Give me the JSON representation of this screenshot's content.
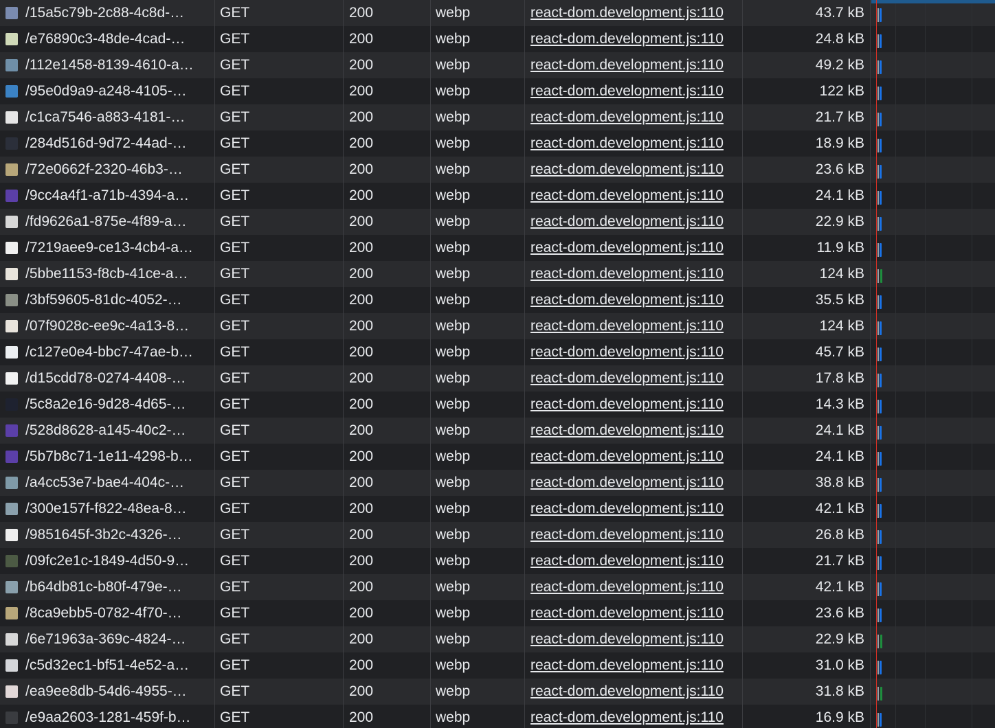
{
  "network": {
    "rows": [
      {
        "name": "/15a5c79b-2c88-4c8d-…",
        "method": "GET",
        "status": "200",
        "type": "webp",
        "initiator": "react-dom.development.js:110",
        "size": "43.7 kB",
        "thumb": "#7a8bb0"
      },
      {
        "name": "/e76890c3-48de-4cad-…",
        "method": "GET",
        "status": "200",
        "type": "webp",
        "initiator": "react-dom.development.js:110",
        "size": "24.8 kB",
        "thumb": "#cfd9b8"
      },
      {
        "name": "/112e1458-8139-4610-a…",
        "method": "GET",
        "status": "200",
        "type": "webp",
        "initiator": "react-dom.development.js:110",
        "size": "49.2 kB",
        "thumb": "#6f8fa8"
      },
      {
        "name": "/95e0d9a9-a248-4105-…",
        "method": "GET",
        "status": "200",
        "type": "webp",
        "initiator": "react-dom.development.js:110",
        "size": "122 kB",
        "thumb": "#3b82c4"
      },
      {
        "name": "/c1ca7546-a883-4181-…",
        "method": "GET",
        "status": "200",
        "type": "webp",
        "initiator": "react-dom.development.js:110",
        "size": "21.7 kB",
        "thumb": "#e6e6e6"
      },
      {
        "name": "/284d516d-9d72-44ad-…",
        "method": "GET",
        "status": "200",
        "type": "webp",
        "initiator": "react-dom.development.js:110",
        "size": "18.9 kB",
        "thumb": "#2b2f3a"
      },
      {
        "name": "/72e0662f-2320-46b3-…",
        "method": "GET",
        "status": "200",
        "type": "webp",
        "initiator": "react-dom.development.js:110",
        "size": "23.6 kB",
        "thumb": "#b8a77a"
      },
      {
        "name": "/9cc4a4f1-a71b-4394-a…",
        "method": "GET",
        "status": "200",
        "type": "webp",
        "initiator": "react-dom.development.js:110",
        "size": "24.1 kB",
        "thumb": "#5b3fa8"
      },
      {
        "name": "/fd9626a1-875e-4f89-a…",
        "method": "GET",
        "status": "200",
        "type": "webp",
        "initiator": "react-dom.development.js:110",
        "size": "22.9 kB",
        "thumb": "#d8d8d8"
      },
      {
        "name": "/7219aee9-ce13-4cb4-a…",
        "method": "GET",
        "status": "200",
        "type": "webp",
        "initiator": "react-dom.development.js:110",
        "size": "11.9 kB",
        "thumb": "#f0f0f0"
      },
      {
        "name": "/5bbe1153-f8cb-41ce-a…",
        "method": "GET",
        "status": "200",
        "type": "webp",
        "initiator": "react-dom.development.js:110",
        "size": "124 kB",
        "thumb": "#e8e4dc"
      },
      {
        "name": "/3bf59605-81dc-4052-…",
        "method": "GET",
        "status": "200",
        "type": "webp",
        "initiator": "react-dom.development.js:110",
        "size": "35.5 kB",
        "thumb": "#8a8f86"
      },
      {
        "name": "/07f9028c-ee9c-4a13-8…",
        "method": "GET",
        "status": "200",
        "type": "webp",
        "initiator": "react-dom.development.js:110",
        "size": "124 kB",
        "thumb": "#e8e4dc"
      },
      {
        "name": "/c127e0e4-bbc7-47ae-b…",
        "method": "GET",
        "status": "200",
        "type": "webp",
        "initiator": "react-dom.development.js:110",
        "size": "45.7 kB",
        "thumb": "#eceff2"
      },
      {
        "name": "/d15cdd78-0274-4408-…",
        "method": "GET",
        "status": "200",
        "type": "webp",
        "initiator": "react-dom.development.js:110",
        "size": "17.8 kB",
        "thumb": "#f2f2f2"
      },
      {
        "name": "/5c8a2e16-9d28-4d65-…",
        "method": "GET",
        "status": "200",
        "type": "webp",
        "initiator": "react-dom.development.js:110",
        "size": "14.3 kB",
        "thumb": "#1e2230"
      },
      {
        "name": "/528d8628-a145-40c2-…",
        "method": "GET",
        "status": "200",
        "type": "webp",
        "initiator": "react-dom.development.js:110",
        "size": "24.1 kB",
        "thumb": "#5b3fa8"
      },
      {
        "name": "/5b7b8c71-1e11-4298-b…",
        "method": "GET",
        "status": "200",
        "type": "webp",
        "initiator": "react-dom.development.js:110",
        "size": "24.1 kB",
        "thumb": "#5b3fa8"
      },
      {
        "name": "/a4cc53e7-bae4-404c-…",
        "method": "GET",
        "status": "200",
        "type": "webp",
        "initiator": "react-dom.development.js:110",
        "size": "38.8 kB",
        "thumb": "#7f9aa8"
      },
      {
        "name": "/300e157f-f822-48ea-8…",
        "method": "GET",
        "status": "200",
        "type": "webp",
        "initiator": "react-dom.development.js:110",
        "size": "42.1 kB",
        "thumb": "#8aa0ac"
      },
      {
        "name": "/9851645f-3b2c-4326-…",
        "method": "GET",
        "status": "200",
        "type": "webp",
        "initiator": "react-dom.development.js:110",
        "size": "26.8 kB",
        "thumb": "#eeeeee"
      },
      {
        "name": "/09fc2e1c-1849-4d50-9…",
        "method": "GET",
        "status": "200",
        "type": "webp",
        "initiator": "react-dom.development.js:110",
        "size": "21.7 kB",
        "thumb": "#4c5a44"
      },
      {
        "name": "/b64db81c-b80f-479e-…",
        "method": "GET",
        "status": "200",
        "type": "webp",
        "initiator": "react-dom.development.js:110",
        "size": "42.1 kB",
        "thumb": "#8aa0ac"
      },
      {
        "name": "/8ca9ebb5-0782-4f70-…",
        "method": "GET",
        "status": "200",
        "type": "webp",
        "initiator": "react-dom.development.js:110",
        "size": "23.6 kB",
        "thumb": "#b8a77a"
      },
      {
        "name": "/6e71963a-369c-4824-…",
        "method": "GET",
        "status": "200",
        "type": "webp",
        "initiator": "react-dom.development.js:110",
        "size": "22.9 kB",
        "thumb": "#d8d8d8"
      },
      {
        "name": "/c5d32ec1-bf51-4e52-a…",
        "method": "GET",
        "status": "200",
        "type": "webp",
        "initiator": "react-dom.development.js:110",
        "size": "31.0 kB",
        "thumb": "#d4d6da"
      },
      {
        "name": "/ea9ee8db-54d6-4955-…",
        "method": "GET",
        "status": "200",
        "type": "webp",
        "initiator": "react-dom.development.js:110",
        "size": "31.8 kB",
        "thumb": "#e2d8d8"
      },
      {
        "name": "/e9aa2603-1281-459f-b…",
        "method": "GET",
        "status": "200",
        "type": "webp",
        "initiator": "react-dom.development.js:110",
        "size": "16.9 kB",
        "thumb": "#3a3c40"
      }
    ]
  },
  "colors": {
    "row_odd": "#2a2b2e",
    "row_even": "#202124",
    "text": "#e8eaed",
    "waterfall_bar": "#1a73e8",
    "waterfall_bar_alt": "#1e8e3e",
    "load_line": "#d93025"
  }
}
